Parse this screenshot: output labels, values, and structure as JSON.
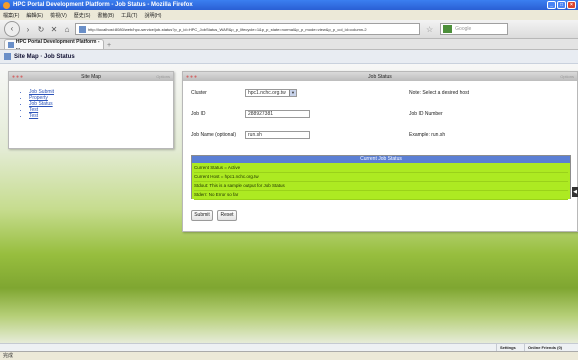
{
  "window": {
    "title": "HPC Portal Development Platform - Job Status - Mozilla Firefox"
  },
  "menu": [
    "檔案(F)",
    "編輯(E)",
    "檢視(V)",
    "歷史(S)",
    "書籤(B)",
    "工具(T)",
    "說明(H)"
  ],
  "nav": {
    "url": "http://localhost:8080/web/hpc-service/job-status?p_p_id=HPC_JobStatus_WAR&p_p_lifecycle=1&p_p_state=normal&p_p_mode=view&p_p_col_id=column-2",
    "search_placeholder": "Google"
  },
  "tab": {
    "label": "HPC Portal Development Platform - ..."
  },
  "bookmarks": {
    "label": "Site Map · Job Status"
  },
  "sitemap": {
    "title": "Site Map",
    "options": "Options",
    "links": [
      "Job Submit",
      "Property",
      "Job Status",
      "Test",
      "Test"
    ]
  },
  "jobstatus": {
    "title": "Job Status",
    "options": "Options",
    "cluster_label": "Cluster",
    "cluster_value": "hpc1.nchc.org.tw",
    "cluster_note": "Note: Select a desired host",
    "jobid_label": "Job ID",
    "jobid_value": "288927381",
    "jobid_note": "Job ID Number",
    "jobname_label": "Job Name (optional)",
    "jobname_value": "run.sh",
    "jobname_note": "Example: run.sh",
    "current_status_title": "Current Job Status",
    "status_lines": [
      "Current Status = Active",
      "Current Host = hpc1.nchc.org.tw",
      "Stdout: This is a sample output for Job Status",
      "Stderr: No Error so far"
    ],
    "submit_label": "Submit",
    "reset_label": "Reset"
  },
  "footer": {
    "settings": "Settings",
    "online_friends": "Online Friends (0)"
  },
  "statusbar": {
    "text": "完成"
  },
  "colors": {
    "status_body": "#adea22",
    "status_head": "#5b7fd4",
    "titlebar": "#2a5fd4"
  }
}
